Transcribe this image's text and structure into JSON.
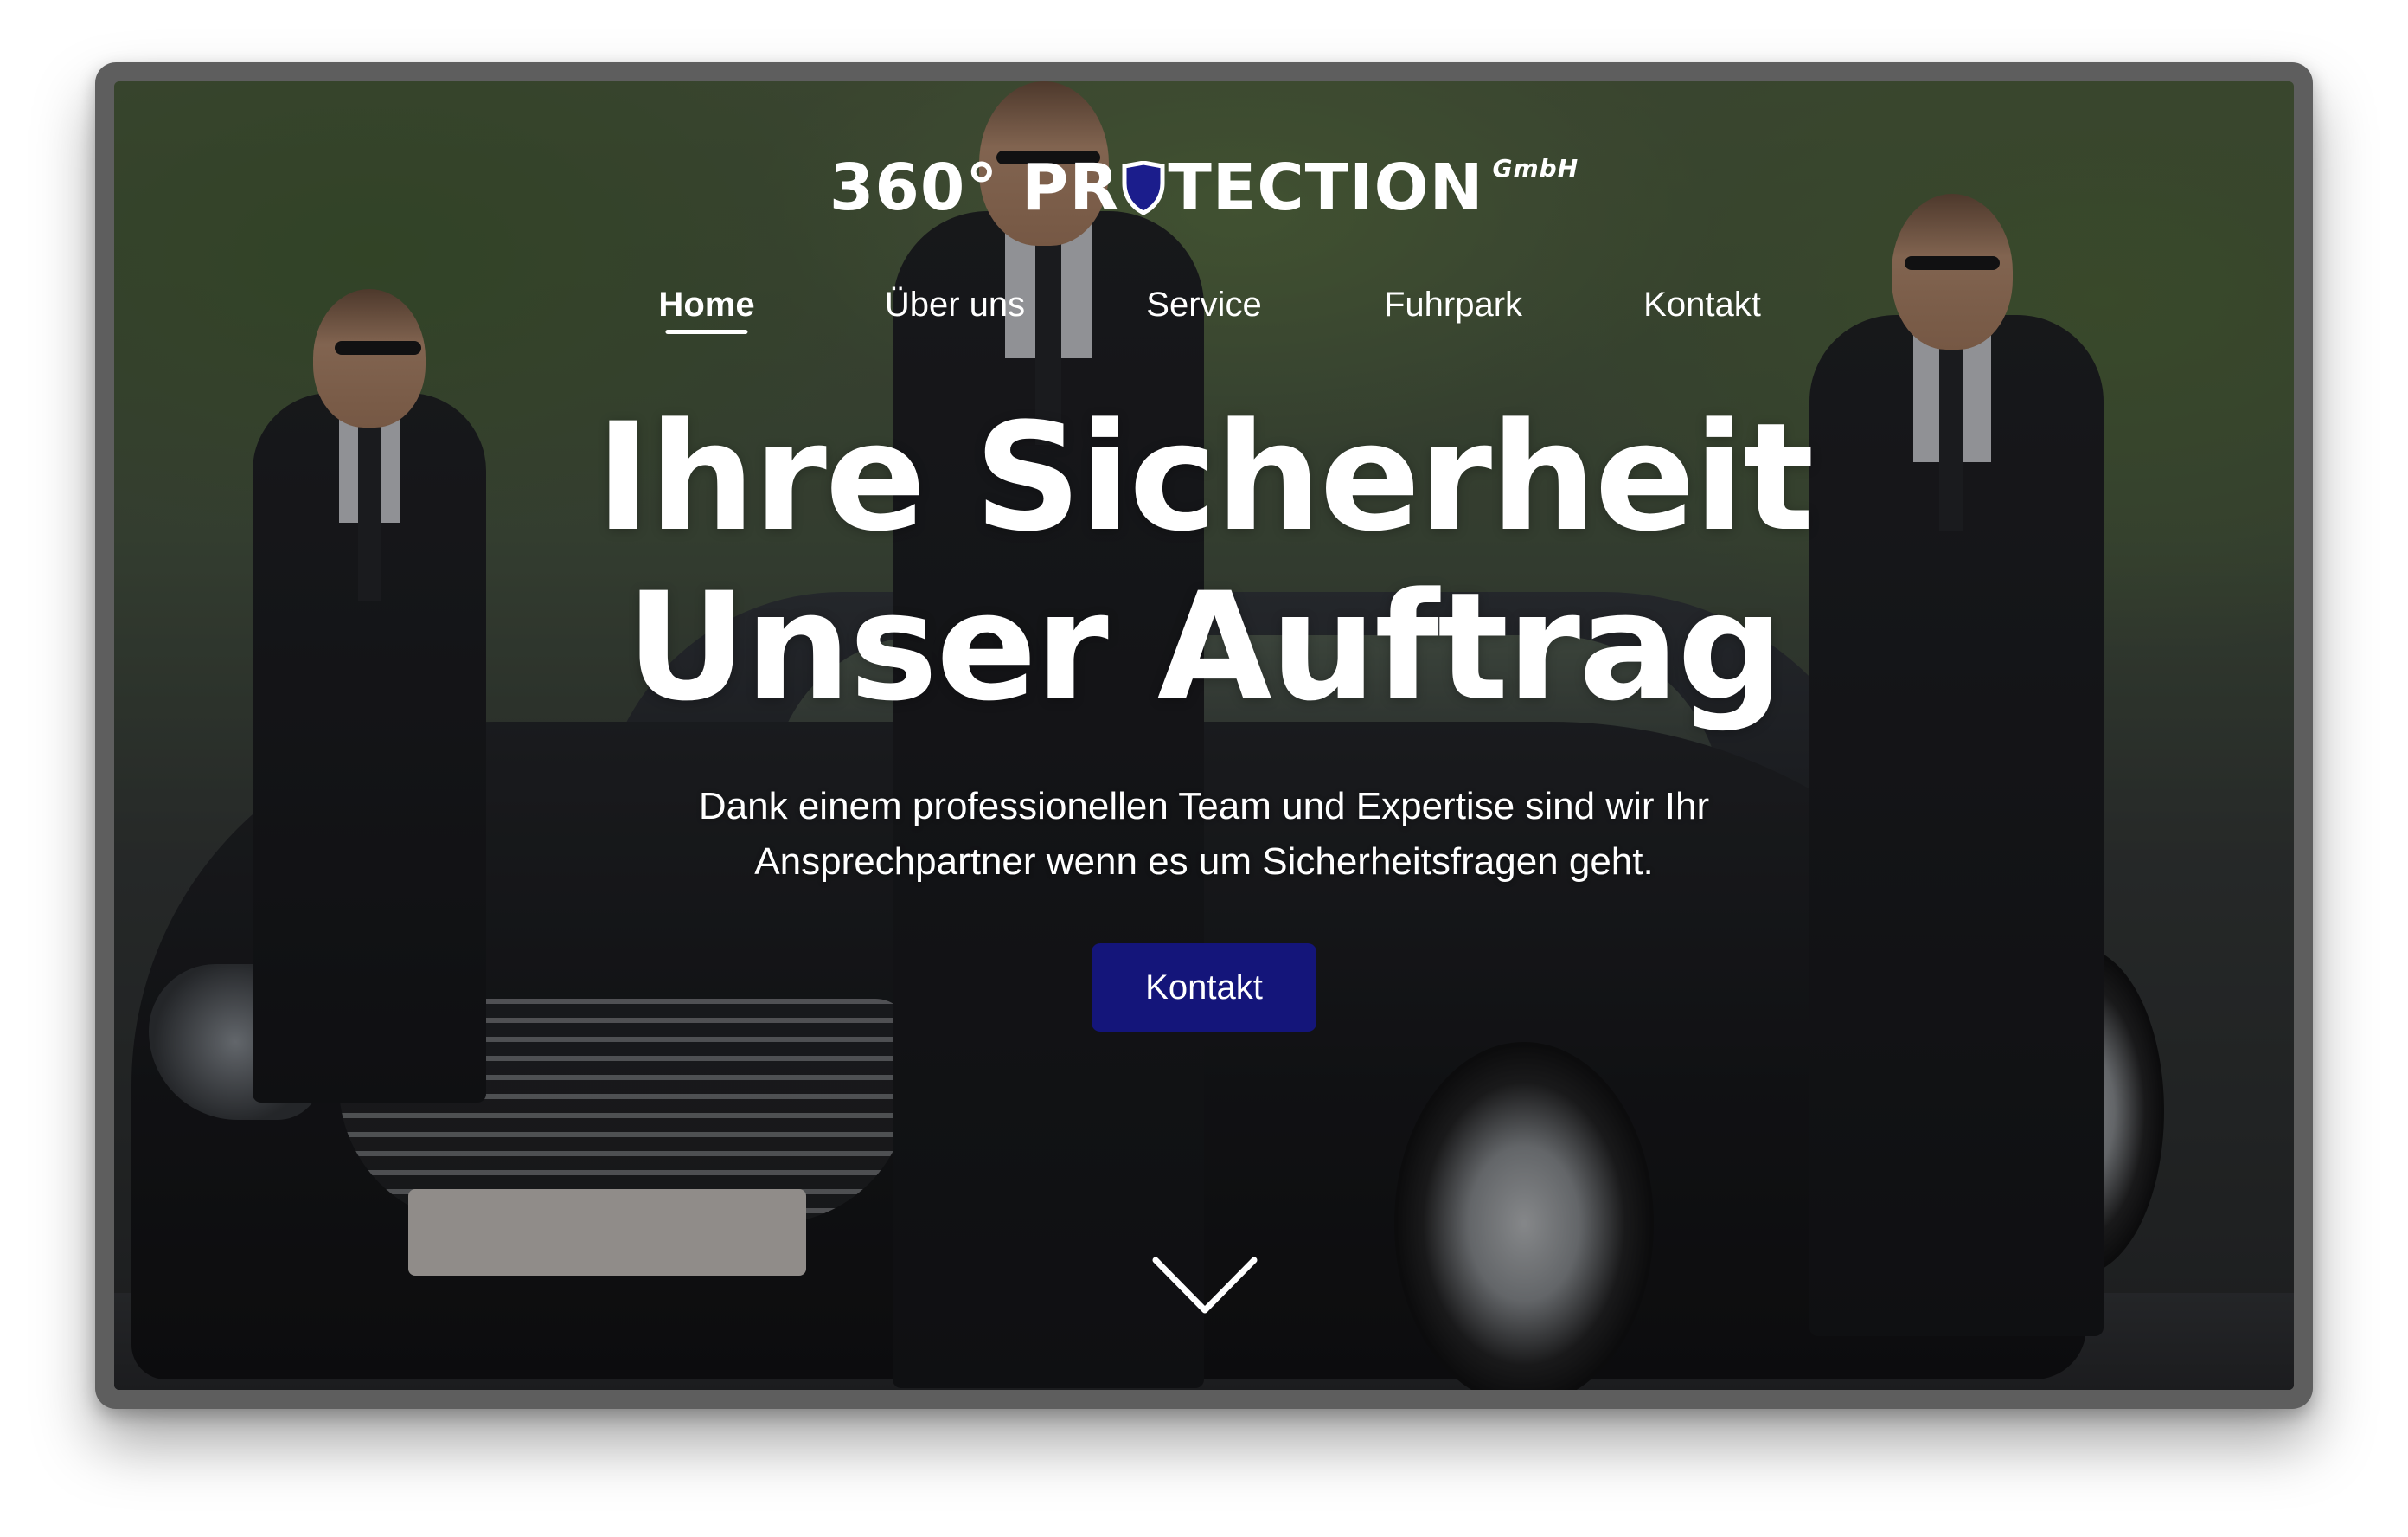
{
  "brand": {
    "name": "360° PR",
    "name_rest": "TECTION",
    "suffix": "GmbH",
    "logo_icon": "shield-icon",
    "accent_color": "#14157a"
  },
  "nav": {
    "items": [
      {
        "label": "Home",
        "active": true
      },
      {
        "label": "Über uns",
        "active": false
      },
      {
        "label": "Service",
        "active": false
      },
      {
        "label": "Fuhrpark",
        "active": false
      },
      {
        "label": "Kontakt",
        "active": false
      }
    ]
  },
  "hero": {
    "headline_line1": "Ihre Sicherheit",
    "headline_line2": "Unser Auftrag",
    "subtitle": "Dank einem professionellen Team und Expertise sind wir Ihr Ansprechpartner wenn es um Sicherheitsfragen geht.",
    "cta_label": "Kontakt",
    "scroll_icon": "chevron-down-icon"
  }
}
